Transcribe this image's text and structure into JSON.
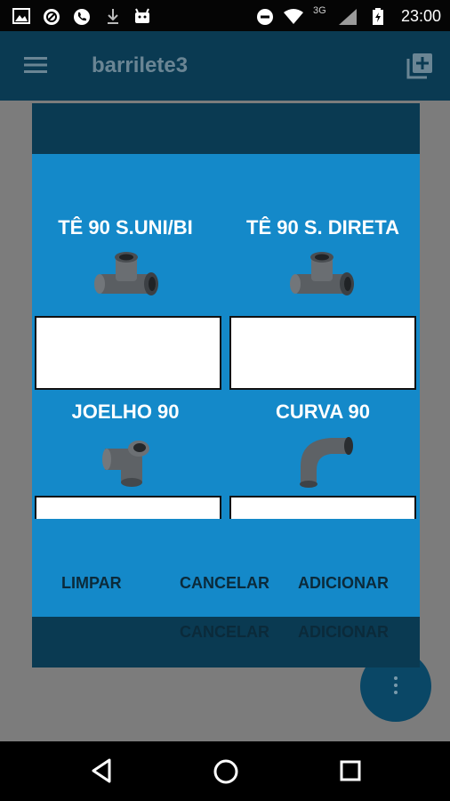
{
  "status_bar": {
    "network_label": "3G",
    "time": "23:00",
    "icons": [
      "image-icon",
      "blocked-icon",
      "phone-icon",
      "download-icon",
      "android-icon",
      "dnd-icon",
      "wifi-icon",
      "signal-icon",
      "battery-charging-icon"
    ]
  },
  "app_bar": {
    "title": "barrilete3",
    "menu_icon": "hamburger-menu-icon",
    "action_icon": "add-to-queue-icon"
  },
  "background": {
    "text": "........ ........ .....\n........ ..... ...\n........ ........ ........\n........ ....."
  },
  "dialog": {
    "items": [
      {
        "title": "TÊ 90 S.UNI/BI",
        "icon": "tee-fitting-icon",
        "value": ""
      },
      {
        "title": "TÊ 90 S. DIRETA",
        "icon": "tee-fitting-icon",
        "value": ""
      },
      {
        "title": "JOELHO 90",
        "icon": "elbow-fitting-icon",
        "value": ""
      },
      {
        "title": "CURVA 90",
        "icon": "bend-fitting-icon",
        "value": ""
      }
    ],
    "buttons": {
      "clear": "LIMPAR",
      "cancel": "CANCELAR",
      "add": "ADICIONAR"
    },
    "outer_buttons": {
      "cancel": "CANCELAR",
      "add": "ADICIONAR"
    }
  },
  "colors": {
    "app_bar": "#0a3a52",
    "dialog_blue": "#1489c9",
    "dialog_dark": "#0a3a52"
  },
  "nav_bar": {
    "icons": [
      "back-icon",
      "home-icon",
      "recents-icon"
    ]
  }
}
